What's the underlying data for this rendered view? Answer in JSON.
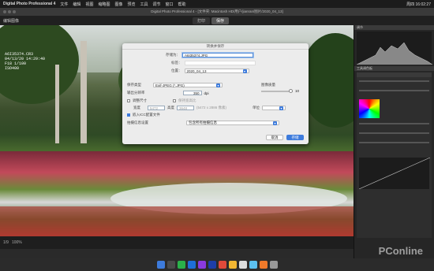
{
  "menubar": {
    "app": "Digital Photo Professional 4",
    "items": [
      "文件",
      "编辑",
      "视图",
      "缩略图",
      "图像",
      "预览",
      "工具",
      "调节",
      "窗口",
      "帮助"
    ],
    "clock": "周四 16:02:27"
  },
  "window": {
    "title": "Digital Photo Professional 4 - [文件夹: Macintosh HD/用户/jianran/图片/2020_04_13]"
  },
  "toolbar": {
    "edit_label": "编辑图像",
    "mode_print": "打印",
    "mode_save": "保存"
  },
  "photo_info": {
    "filename": "A6I35374.CR3",
    "datetime": "04/13/20 14:29:40",
    "aperture_shutter": "F18 1/100",
    "iso": "ISO400"
  },
  "dialog": {
    "title": "转换并保存",
    "save_as_label": "存储为：",
    "save_as_value": "A6I35374.JPG",
    "tags_label": "标签：",
    "location_label": "位置：",
    "location_value": "2020_04_13",
    "file_type_label": "保存类型",
    "file_type_value": "Exif-JPEG (*.JPG)",
    "quality_label": "图像质量",
    "quality_value": "10",
    "resolution_label": "输出分辨率",
    "resolution_value": "350",
    "resolution_unit": "dpi",
    "resize_label": "调整尺寸",
    "keep_ratio_label": "保持宽高比",
    "width_label": "宽度",
    "width_value": "5472",
    "height_label": "高度",
    "height_value": "3648",
    "dims_text": "(5472 x 2886 像素)",
    "unit_label": "单位",
    "icc_label": "嵌入ICC配置文件",
    "privacy_label": "拍摄信息设置",
    "privacy_value": "包含所有拍摄信息",
    "cancel_label": "取消",
    "save_label": "存储"
  },
  "rightpanel": {
    "histogram_title": "调节",
    "tool_title": "工具调色板"
  },
  "status": {
    "page": "1/9",
    "zoom": "100%"
  },
  "watermark": "PConline"
}
